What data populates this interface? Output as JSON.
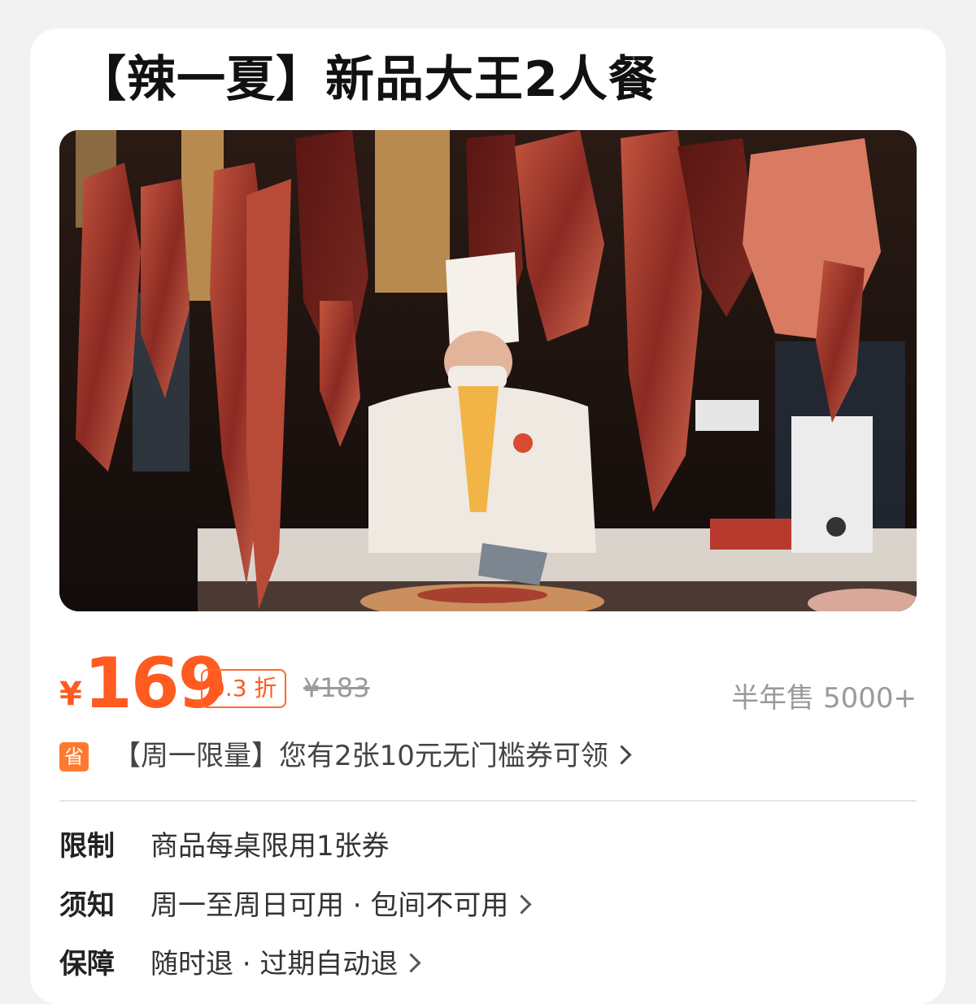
{
  "product": {
    "title": "【辣一夏】新品大王2人餐"
  },
  "price": {
    "currency": "¥",
    "current": "169",
    "discount": "9.3 折",
    "original": "¥183",
    "sales": "半年售 5000+"
  },
  "coupon": {
    "icon_label": "省",
    "text": "【周一限量】您有2张10元无门槛券可领"
  },
  "info": [
    {
      "label": "限制",
      "value": "商品每桌限用1张券",
      "has_arrow": false
    },
    {
      "label": "须知",
      "value": "周一至周日可用 · 包间不可用",
      "has_arrow": true
    },
    {
      "label": "保障",
      "value": "随时退 · 过期自动退",
      "has_arrow": true
    }
  ],
  "colors": {
    "accent": "#ff5a1f",
    "muted": "#9a9a9a"
  },
  "icons": {
    "coupon": "save-icon",
    "arrow": "chevron-right-icon"
  }
}
